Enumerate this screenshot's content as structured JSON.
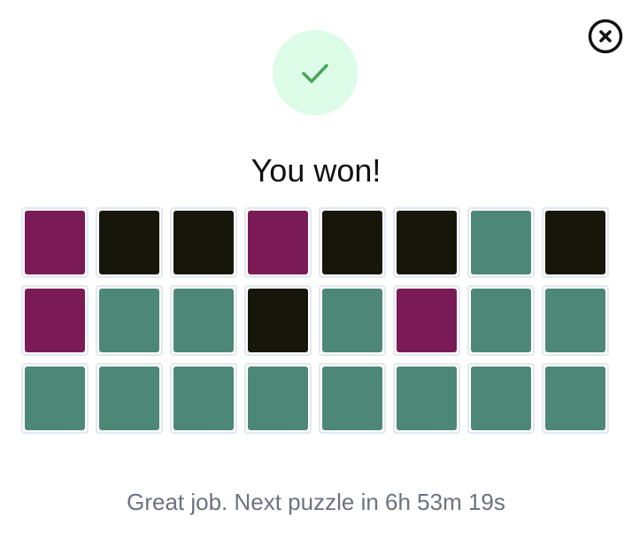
{
  "modal": {
    "title": "You won!",
    "message": "Great job. Next puzzle in 6h 53m 19s",
    "close_icon": "close-icon",
    "success_icon": "check-icon"
  },
  "colors": {
    "purple": "#7a1a56",
    "dark": "#16170a",
    "green": "#4d8876",
    "success_bg": "#dcfce7",
    "success_check": "#4ca35c"
  },
  "grid": {
    "rows": [
      [
        "purple",
        "dark",
        "dark",
        "purple",
        "dark",
        "dark",
        "green",
        "dark"
      ],
      [
        "purple",
        "green",
        "green",
        "dark",
        "green",
        "purple",
        "green",
        "green"
      ],
      [
        "green",
        "green",
        "green",
        "green",
        "green",
        "green",
        "green",
        "green"
      ]
    ]
  }
}
